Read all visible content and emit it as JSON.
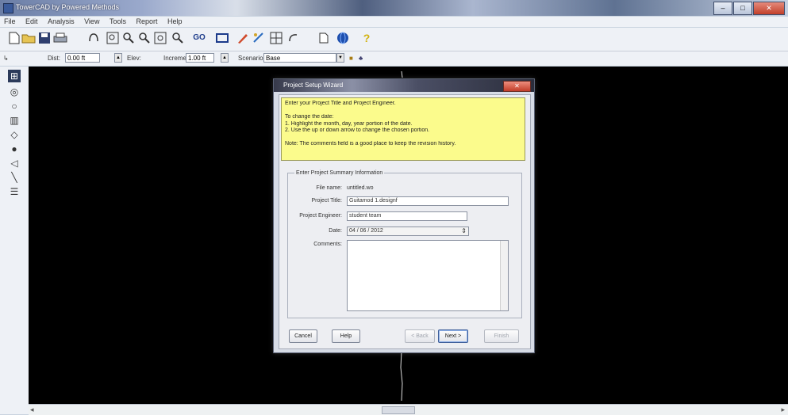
{
  "window": {
    "title": "TowerCAD by Powered Methods"
  },
  "menu": [
    "File",
    "Edit",
    "Analysis",
    "View",
    "Tools",
    "Report",
    "Help"
  ],
  "toolbar1": {
    "icons": [
      "new-file",
      "open-folder",
      "save",
      "print",
      "undo-curve",
      "zoom-window",
      "zoom-in",
      "zoom-out",
      "zoom-extents",
      "pan",
      "go",
      "rectangle",
      "pencil",
      "pen-tool",
      "grid",
      "rotate",
      "insert",
      "globe",
      "help"
    ],
    "go_label": "GO",
    "help_glyph": "?"
  },
  "toolbar2": {
    "dist_label": "Dist:",
    "dist_value": "0.00 ft",
    "elev_label": "Elev:",
    "increment_label": "Increment",
    "increment_value": "1.00 ft",
    "scenario_label": "Scenario",
    "scenario_value": "Base"
  },
  "palette": [
    "select-icon",
    "circle-node-icon",
    "small-node-icon",
    "bar-chart-icon",
    "shape-icon",
    "dot-icon",
    "triangle-icon",
    "line-icon",
    "list-icon"
  ],
  "dialog": {
    "title": "Project Setup Wizard",
    "close_glyph": "✕",
    "instructions": [
      "Enter your Project Title and Project Engineer.",
      "",
      "To change the date:",
      "1.  Highlight the month, day, year portion of the date.",
      "2.  Use the up or down arrow to change the chosen portion.",
      "",
      "Note:  The comments field is a good place to keep the revision history."
    ],
    "group_label": "Enter Project Summary Information",
    "fields": {
      "file_name_label": "File name:",
      "file_name_value": "untitled.wo",
      "project_title_label": "Project Title:",
      "project_title_value": "Guitamod 1.designf",
      "project_engineer_label": "Project Engineer:",
      "project_engineer_value": "student team",
      "date_label": "Date:",
      "date_value": "04 / 06 / 2012",
      "comments_label": "Comments:",
      "comments_value": ""
    },
    "buttons": {
      "cancel": "Cancel",
      "help": "Help",
      "back": "< Back",
      "next": "Next >",
      "finish": "Finish"
    }
  },
  "colors": {
    "canvas": "#000000",
    "instructions_bg": "#fbfb8c",
    "dialog_bg": "#edeef2"
  }
}
